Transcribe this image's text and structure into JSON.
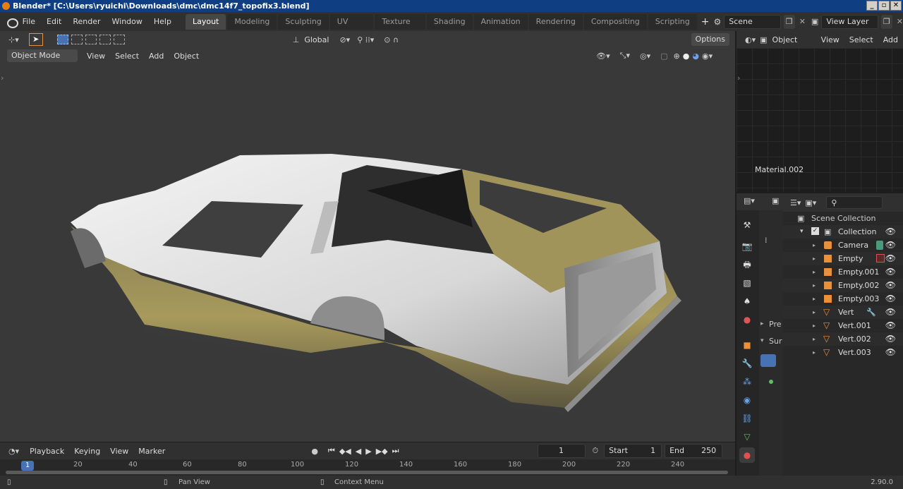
{
  "window": {
    "title": "Blender* [C:\\Users\\ryuichi\\Downloads\\dmc\\dmc14f7_topofix3.blend]",
    "controls": [
      "_",
      "▫",
      "✕"
    ]
  },
  "menus": [
    "File",
    "Edit",
    "Render",
    "Window",
    "Help"
  ],
  "workspaces": [
    {
      "label": "Layout",
      "active": true
    },
    {
      "label": "Modeling"
    },
    {
      "label": "Sculpting"
    },
    {
      "label": "UV Editing"
    },
    {
      "label": "Texture Paint"
    },
    {
      "label": "Shading"
    },
    {
      "label": "Animation"
    },
    {
      "label": "Rendering"
    },
    {
      "label": "Compositing"
    },
    {
      "label": "Scripting"
    }
  ],
  "add_workspace": "+",
  "scene": {
    "label": "Scene"
  },
  "view_layer": {
    "label": "View Layer"
  },
  "viewport": {
    "transform_orientation": "Global",
    "options": "Options",
    "mode": "Object Mode",
    "header_menus": [
      "View",
      "Select",
      "Add",
      "Object"
    ]
  },
  "node_editor": {
    "object_select": "Object",
    "menus": [
      "View",
      "Select",
      "Add"
    ],
    "material_label": "Material.002"
  },
  "properties": {
    "section_a": "Pre",
    "section_b": "Sur"
  },
  "outliner": {
    "search_placeholder": "",
    "scene_collection": "Scene Collection",
    "collection": "Collection",
    "items": [
      {
        "name": "Camera",
        "icon": "camera-icon",
        "color": "#e8903c"
      },
      {
        "name": "Empty",
        "icon": "empty-icon",
        "color": "#e8903c"
      },
      {
        "name": "Empty.001",
        "icon": "empty-icon",
        "color": "#e8903c"
      },
      {
        "name": "Empty.002",
        "icon": "empty-icon",
        "color": "#e8903c"
      },
      {
        "name": "Empty.003",
        "icon": "empty-icon",
        "color": "#e8903c"
      },
      {
        "name": "Vert",
        "icon": "mesh-icon",
        "color": "#e8903c"
      },
      {
        "name": "Vert.001",
        "icon": "mesh-icon",
        "color": "#e8903c"
      },
      {
        "name": "Vert.002",
        "icon": "mesh-icon",
        "color": "#e8903c"
      },
      {
        "name": "Vert.003",
        "icon": "mesh-icon",
        "color": "#e8903c"
      }
    ]
  },
  "timeline": {
    "menus": [
      "Playback",
      "Keying",
      "View",
      "Marker"
    ],
    "current_frame": "1",
    "start_label": "Start",
    "start_value": "1",
    "end_label": "End",
    "end_value": "250",
    "ticks": [
      "1",
      "20",
      "40",
      "60",
      "80",
      "100",
      "120",
      "140",
      "160",
      "180",
      "200",
      "220",
      "240"
    ]
  },
  "status": {
    "pan": "Pan View",
    "context": "Context Menu",
    "version": "2.90.0"
  },
  "colors": {
    "accent": "#4772b3",
    "active_object": "#e8903c",
    "title_bar": "#0f3f82"
  }
}
